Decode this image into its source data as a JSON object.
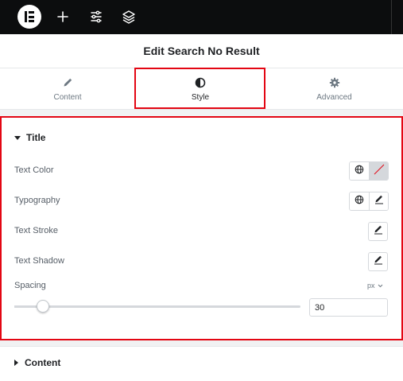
{
  "topbar": {
    "icons": [
      "elementor-logo-icon",
      "plus-icon",
      "sliders-icon",
      "layers-icon"
    ]
  },
  "panel": {
    "title": "Edit Search No Result"
  },
  "tabs": [
    {
      "label": "Content",
      "icon": "pencil-icon",
      "active": false
    },
    {
      "label": "Style",
      "icon": "half-circle-icon",
      "active": true
    },
    {
      "label": "Advanced",
      "icon": "gear-icon",
      "active": false
    }
  ],
  "section_title": {
    "heading": "Title",
    "expanded": true,
    "controls": {
      "text_color": {
        "label": "Text Color"
      },
      "typography": {
        "label": "Typography"
      },
      "text_stroke": {
        "label": "Text Stroke"
      },
      "text_shadow": {
        "label": "Text Shadow"
      },
      "spacing": {
        "label": "Spacing",
        "unit": "px",
        "value": "30",
        "slider_fraction": 0.1
      }
    }
  },
  "section_content": {
    "heading": "Content",
    "expanded": false
  },
  "colors": {
    "highlight": "#e30613",
    "topbar_bg": "#0c0d0e"
  }
}
